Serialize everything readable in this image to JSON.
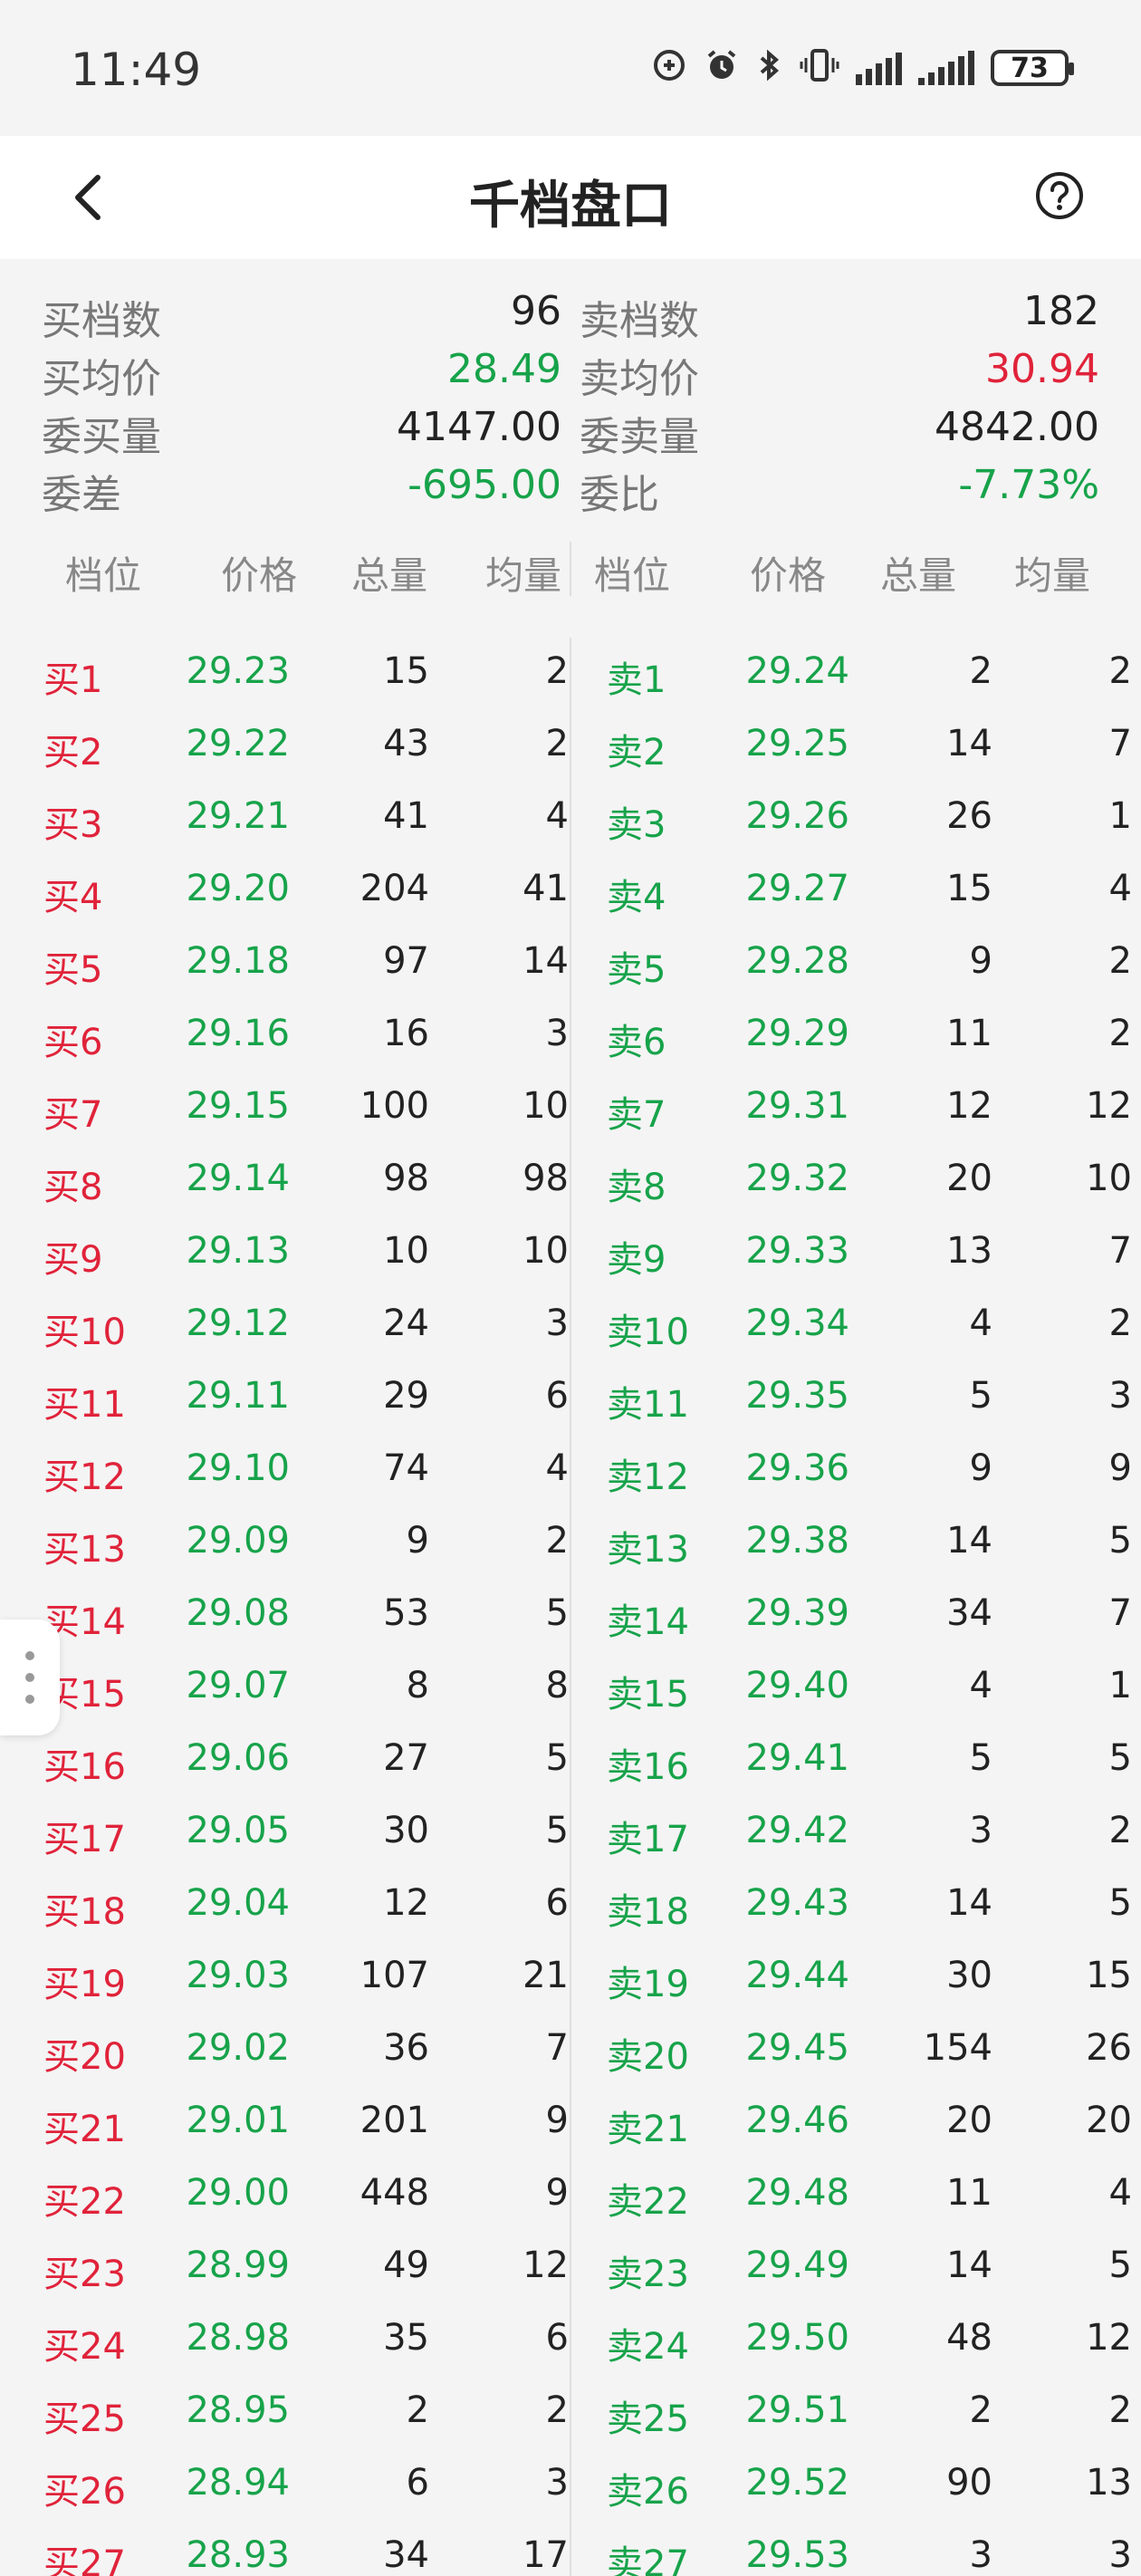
{
  "status": {
    "time": "11:49",
    "battery": "73"
  },
  "header": {
    "title": "千档盘口"
  },
  "summary": {
    "buy_count_label": "买档数",
    "buy_count": "96",
    "sell_count_label": "卖档数",
    "sell_count": "182",
    "buy_avg_label": "买均价",
    "buy_avg": "28.49",
    "sell_avg_label": "卖均价",
    "sell_avg": "30.94",
    "buy_vol_label": "委买量",
    "buy_vol": "4147.00",
    "sell_vol_label": "委卖量",
    "sell_vol": "4842.00",
    "diff_label": "委差",
    "diff": "-695.00",
    "ratio_label": "委比",
    "ratio": "-7.73%"
  },
  "columns": {
    "level": "档位",
    "price": "价格",
    "total": "总量",
    "avg": "均量",
    "level2": "档位",
    "price2": "价格",
    "total2": "总量",
    "avg2": "均量"
  },
  "colors": {
    "up": "#e0233a",
    "down": "#17a34a"
  },
  "rows": [
    {
      "bl": "买1",
      "bp": "29.23",
      "bt": "15",
      "ba": "2",
      "sl": "卖1",
      "sp": "29.24",
      "st": "2",
      "sa": "2"
    },
    {
      "bl": "买2",
      "bp": "29.22",
      "bt": "43",
      "ba": "2",
      "sl": "卖2",
      "sp": "29.25",
      "st": "14",
      "sa": "7"
    },
    {
      "bl": "买3",
      "bp": "29.21",
      "bt": "41",
      "ba": "4",
      "sl": "卖3",
      "sp": "29.26",
      "st": "26",
      "sa": "1"
    },
    {
      "bl": "买4",
      "bp": "29.20",
      "bt": "204",
      "ba": "41",
      "sl": "卖4",
      "sp": "29.27",
      "st": "15",
      "sa": "4"
    },
    {
      "bl": "买5",
      "bp": "29.18",
      "bt": "97",
      "ba": "14",
      "sl": "卖5",
      "sp": "29.28",
      "st": "9",
      "sa": "2"
    },
    {
      "bl": "买6",
      "bp": "29.16",
      "bt": "16",
      "ba": "3",
      "sl": "卖6",
      "sp": "29.29",
      "st": "11",
      "sa": "2"
    },
    {
      "bl": "买7",
      "bp": "29.15",
      "bt": "100",
      "ba": "10",
      "sl": "卖7",
      "sp": "29.31",
      "st": "12",
      "sa": "12"
    },
    {
      "bl": "买8",
      "bp": "29.14",
      "bt": "98",
      "ba": "98",
      "sl": "卖8",
      "sp": "29.32",
      "st": "20",
      "sa": "10"
    },
    {
      "bl": "买9",
      "bp": "29.13",
      "bt": "10",
      "ba": "10",
      "sl": "卖9",
      "sp": "29.33",
      "st": "13",
      "sa": "7"
    },
    {
      "bl": "买10",
      "bp": "29.12",
      "bt": "24",
      "ba": "3",
      "sl": "卖10",
      "sp": "29.34",
      "st": "4",
      "sa": "2"
    },
    {
      "bl": "买11",
      "bp": "29.11",
      "bt": "29",
      "ba": "6",
      "sl": "卖11",
      "sp": "29.35",
      "st": "5",
      "sa": "3"
    },
    {
      "bl": "买12",
      "bp": "29.10",
      "bt": "74",
      "ba": "4",
      "sl": "卖12",
      "sp": "29.36",
      "st": "9",
      "sa": "9"
    },
    {
      "bl": "买13",
      "bp": "29.09",
      "bt": "9",
      "ba": "2",
      "sl": "卖13",
      "sp": "29.38",
      "st": "14",
      "sa": "5"
    },
    {
      "bl": "买14",
      "bp": "29.08",
      "bt": "53",
      "ba": "5",
      "sl": "卖14",
      "sp": "29.39",
      "st": "34",
      "sa": "7"
    },
    {
      "bl": "买15",
      "bp": "29.07",
      "bt": "8",
      "ba": "8",
      "sl": "卖15",
      "sp": "29.40",
      "st": "4",
      "sa": "1"
    },
    {
      "bl": "买16",
      "bp": "29.06",
      "bt": "27",
      "ba": "5",
      "sl": "卖16",
      "sp": "29.41",
      "st": "5",
      "sa": "5"
    },
    {
      "bl": "买17",
      "bp": "29.05",
      "bt": "30",
      "ba": "5",
      "sl": "卖17",
      "sp": "29.42",
      "st": "3",
      "sa": "2"
    },
    {
      "bl": "买18",
      "bp": "29.04",
      "bt": "12",
      "ba": "6",
      "sl": "卖18",
      "sp": "29.43",
      "st": "14",
      "sa": "5"
    },
    {
      "bl": "买19",
      "bp": "29.03",
      "bt": "107",
      "ba": "21",
      "sl": "卖19",
      "sp": "29.44",
      "st": "30",
      "sa": "15"
    },
    {
      "bl": "买20",
      "bp": "29.02",
      "bt": "36",
      "ba": "7",
      "sl": "卖20",
      "sp": "29.45",
      "st": "154",
      "sa": "26"
    },
    {
      "bl": "买21",
      "bp": "29.01",
      "bt": "201",
      "ba": "9",
      "sl": "卖21",
      "sp": "29.46",
      "st": "20",
      "sa": "20"
    },
    {
      "bl": "买22",
      "bp": "29.00",
      "bt": "448",
      "ba": "9",
      "sl": "卖22",
      "sp": "29.48",
      "st": "11",
      "sa": "4"
    },
    {
      "bl": "买23",
      "bp": "28.99",
      "bt": "49",
      "ba": "12",
      "sl": "卖23",
      "sp": "29.49",
      "st": "14",
      "sa": "5"
    },
    {
      "bl": "买24",
      "bp": "28.98",
      "bt": "35",
      "ba": "6",
      "sl": "卖24",
      "sp": "29.50",
      "st": "48",
      "sa": "12"
    },
    {
      "bl": "买25",
      "bp": "28.95",
      "bt": "2",
      "ba": "2",
      "sl": "卖25",
      "sp": "29.51",
      "st": "2",
      "sa": "2"
    },
    {
      "bl": "买26",
      "bp": "28.94",
      "bt": "6",
      "ba": "3",
      "sl": "卖26",
      "sp": "29.52",
      "st": "90",
      "sa": "13"
    },
    {
      "bl": "买27",
      "bp": "28.93",
      "bt": "34",
      "ba": "17",
      "sl": "卖27",
      "sp": "29.53",
      "st": "3",
      "sa": "3"
    }
  ]
}
